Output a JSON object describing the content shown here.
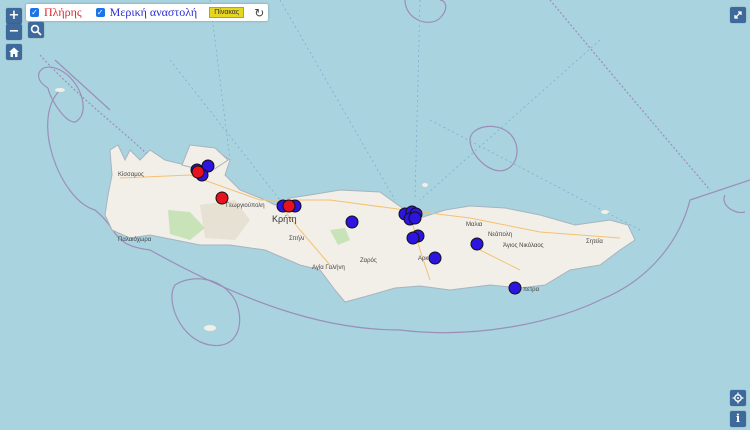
{
  "legend": {
    "full_label": "Πλήρης",
    "partial_label": "Μερική αναστολή",
    "table_button": "Πίνακας",
    "full_checked": true,
    "partial_checked": true
  },
  "controls": {
    "zoom_in": "+",
    "zoom_out": "−",
    "info": "i",
    "icons": [
      "search-icon",
      "home-icon",
      "fullscreen-icon",
      "locate-icon",
      "refresh-icon"
    ]
  },
  "places": {
    "kissamos": "Κίσσαμος",
    "georgioupoli": "Γεωργιούπολη",
    "kriti": "Κρήτη",
    "spili": "Σπήλι",
    "agia_galini": "Αγία Γαλήνη",
    "zaros": "Ζαρός",
    "arkalochori": "Αρκ",
    "malia": "Μαλια",
    "neapoli": "Νεάπολη",
    "agios_nikolaos": "Άγιος Νικόλαος",
    "sitia": "Σητεία",
    "ierapetra": "πετρα",
    "paleochora": "Παλαιόχωρα"
  },
  "colors": {
    "sea": "#a9d3df",
    "land": "#f2efe9",
    "full_marker": "#e8121e",
    "partial_marker": "#2d14e0",
    "boundary": "#8f7fa8"
  },
  "markers_note_series": [
    "full",
    "partial"
  ]
}
